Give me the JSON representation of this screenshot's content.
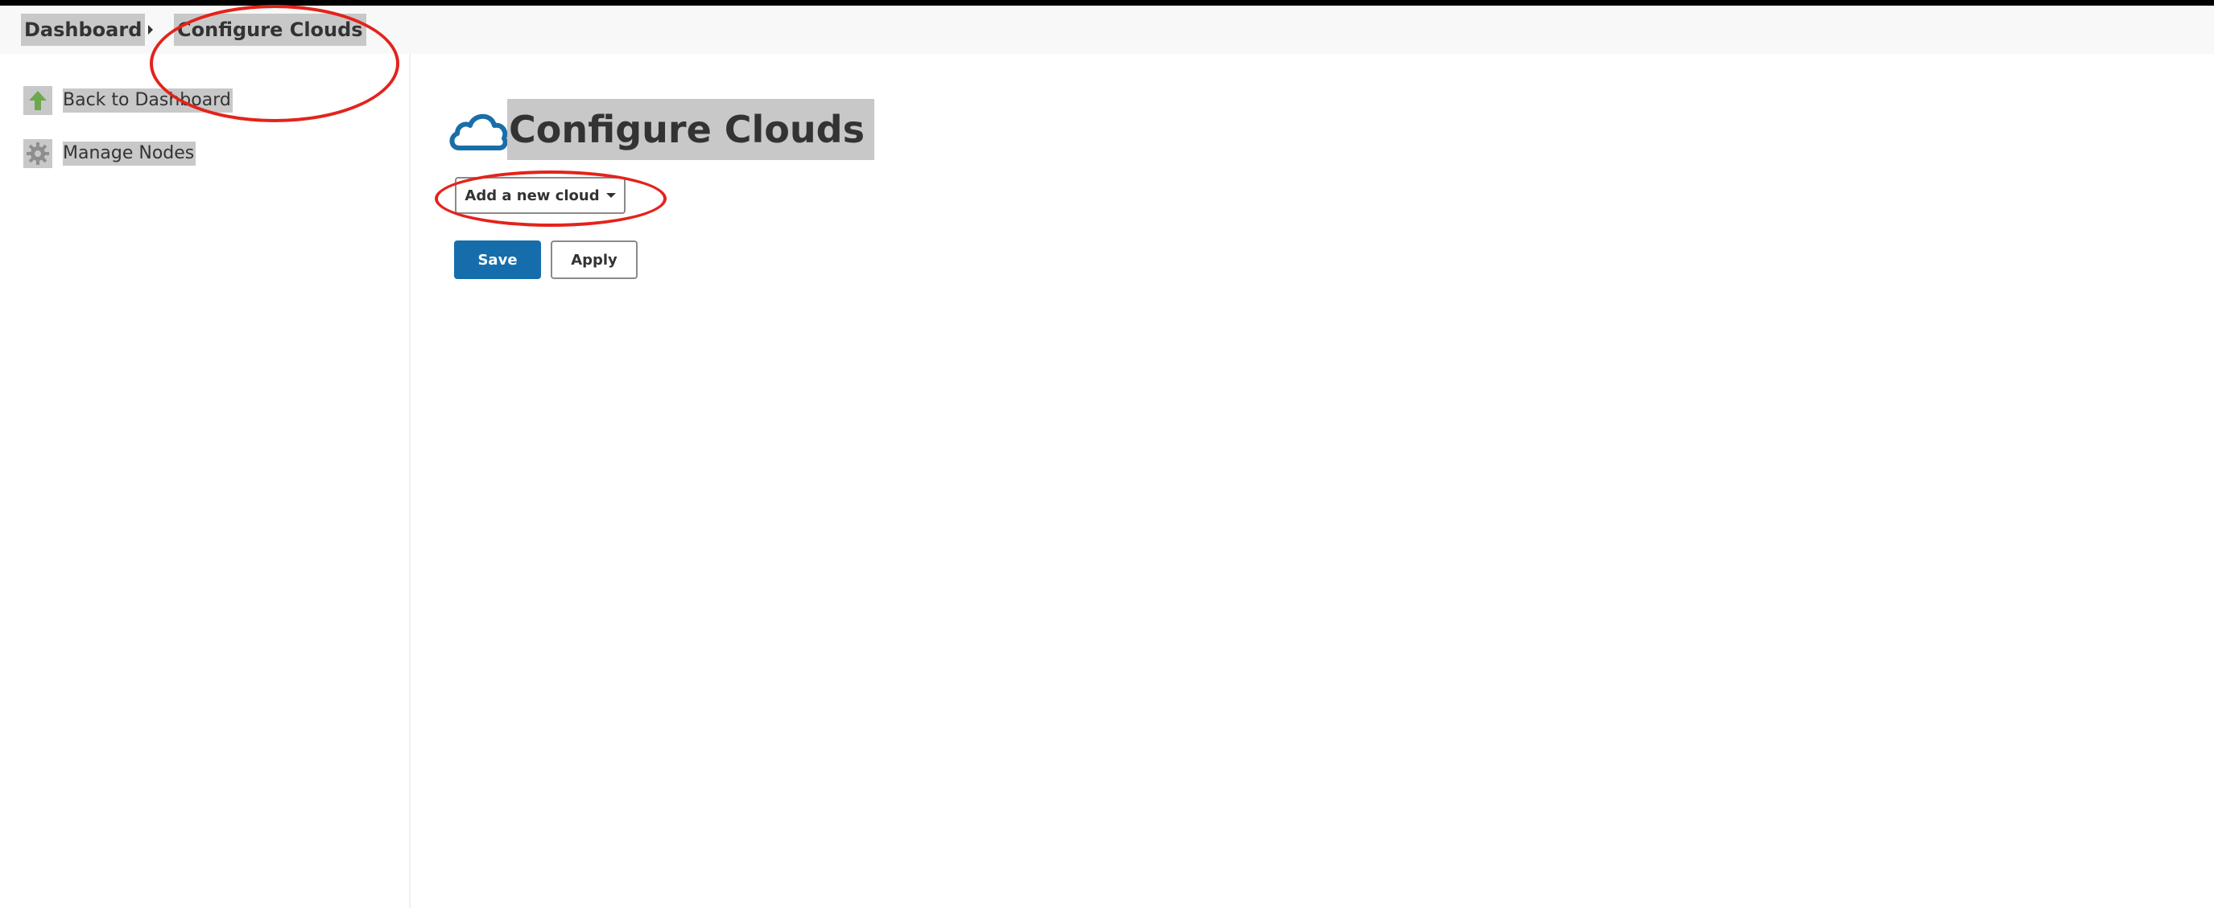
{
  "breadcrumb": {
    "items": [
      "Dashboard",
      "Configure Clouds"
    ]
  },
  "sidebar": {
    "items": [
      {
        "label": "Back to Dashboard",
        "icon": "up-arrow-icon"
      },
      {
        "label": "Manage Nodes",
        "icon": "gear-icon"
      }
    ]
  },
  "main": {
    "title": "Configure Clouds",
    "title_icon": "cloud-icon",
    "add_cloud_label": "Add a new cloud",
    "save_label": "Save",
    "apply_label": "Apply"
  },
  "colors": {
    "primary_button": "#156eab",
    "text": "#333333",
    "highlight": "#c8c8c8",
    "annotation": "#e3231b",
    "cloud_icon": "#1a6ea8",
    "arrow_icon": "#6ea84e"
  }
}
